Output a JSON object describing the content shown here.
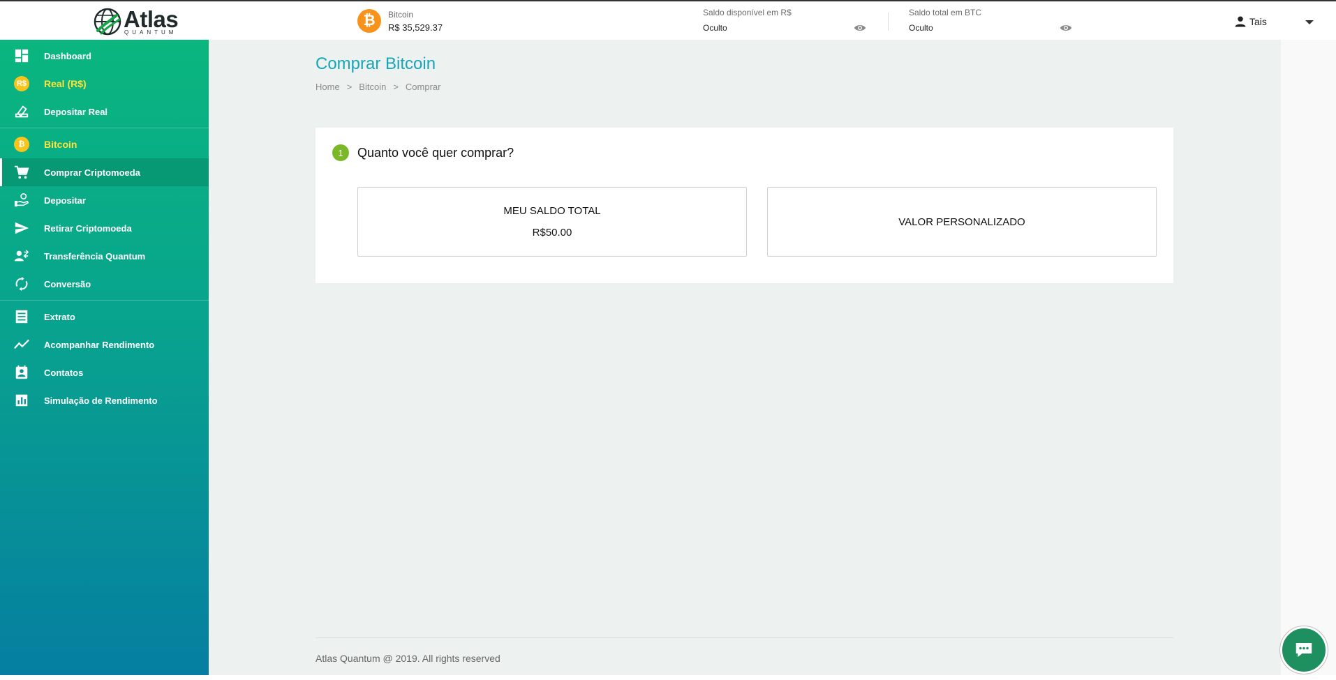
{
  "header": {
    "logo_main": "Atlas",
    "logo_sub": "QUANTUM",
    "ticker": {
      "label": "Bitcoin",
      "value": "R$ 35,529.37",
      "icon": "bitcoin-icon",
      "symbol": "₿"
    },
    "balance_brl": {
      "label": "Saldo disponível em R$",
      "value": "Oculto",
      "icon": "eye-icon"
    },
    "balance_btc": {
      "label": "Saldo total em BTC",
      "value": "Oculto",
      "icon": "eye-icon"
    },
    "user": {
      "name": "Tais",
      "icon": "user-icon"
    }
  },
  "sidebar": {
    "groups": [
      [
        {
          "label": "Dashboard",
          "icon": "dashboard-icon"
        },
        {
          "label": "Real (R$)",
          "icon": "real-coin-icon",
          "badge": "R$",
          "highlight": true
        },
        {
          "label": "Depositar Real",
          "icon": "deposit-icon"
        }
      ],
      [
        {
          "label": "Bitcoin",
          "icon": "bitcoin-icon",
          "badge": "₿",
          "highlight": true
        },
        {
          "label": "Comprar Criptomoeda",
          "icon": "cart-icon",
          "active": true
        },
        {
          "label": "Depositar",
          "icon": "hand-coin-icon"
        },
        {
          "label": "Retirar Criptomoeda",
          "icon": "send-icon"
        },
        {
          "label": "Transferência Quantum",
          "icon": "transfer-icon"
        },
        {
          "label": "Conversão",
          "icon": "sync-icon"
        }
      ],
      [
        {
          "label": "Extrato",
          "icon": "statement-icon"
        },
        {
          "label": "Acompanhar Rendimento",
          "icon": "trend-icon"
        },
        {
          "label": "Contatos",
          "icon": "contacts-icon"
        },
        {
          "label": "Simulação de Rendimento",
          "icon": "bar-chart-icon"
        }
      ]
    ]
  },
  "main": {
    "title": "Comprar Bitcoin",
    "breadcrumb": [
      "Home",
      "Bitcoin",
      "Comprar"
    ],
    "breadcrumb_sep": ">",
    "step": {
      "number": "1",
      "question": "Quanto você quer comprar?",
      "options": [
        {
          "title": "MEU SALDO TOTAL",
          "value": "R$50.00"
        },
        {
          "title": "VALOR PERSONALIZADO",
          "value": ""
        }
      ]
    },
    "footer": "Atlas Quantum @ 2019. All rights reserved"
  },
  "chat": {
    "icon": "chat-icon"
  },
  "colors": {
    "brand_teal": "#17a5b8",
    "sidebar_top": "#0ab67e",
    "sidebar_bottom": "#067ea1",
    "highlight_yellow": "#ffe23a",
    "bitcoin_orange": "#f7931a",
    "step_green": "#7ab827",
    "chat_green": "#1e8f5f"
  }
}
